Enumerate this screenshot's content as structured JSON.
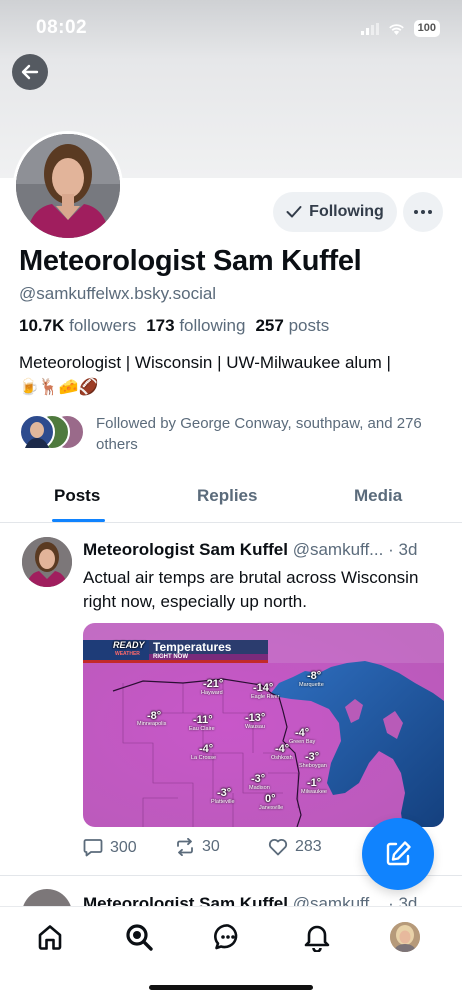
{
  "status_bar": {
    "time": "08:02",
    "battery": "100"
  },
  "profile": {
    "display_name": "Meteorologist Sam Kuffel",
    "handle": "@samkuffelwx.bsky.social",
    "followers_count": "10.7K",
    "followers_label": "followers",
    "following_count": "173",
    "following_label": "following",
    "posts_count": "257",
    "posts_label": "posts",
    "bio_line1": "Meteorologist | Wisconsin | UW-Milwaukee alum |",
    "bio_emojis": "🍺🦌🧀🏈",
    "followed_by": "Followed by George Conway, southpaw, and 276 others",
    "following_button": "Following"
  },
  "tabs": [
    {
      "label": "Posts",
      "active": true
    },
    {
      "label": "Replies",
      "active": false
    },
    {
      "label": "Media",
      "active": false
    }
  ],
  "post": {
    "author": "Meteorologist Sam Kuffel",
    "handle": "@samkuff...",
    "dot": "·",
    "time": "3d",
    "text": "Actual air temps are brutal across Wisconsin right now, especially up north.",
    "replies": "300",
    "reposts": "30",
    "likes": "283",
    "image": {
      "brand_line1": "READY",
      "brand_line2": "WEATHER",
      "title": "Temperatures",
      "subtitle": "RIGHT NOW",
      "readings": [
        {
          "temp": "-21°",
          "city": "Hayward"
        },
        {
          "temp": "-14°",
          "city": "Eagle River"
        },
        {
          "temp": "-8°",
          "city": "Marquette"
        },
        {
          "temp": "-8°",
          "city": "Minneapolis"
        },
        {
          "temp": "-11°",
          "city": "Eau Claire"
        },
        {
          "temp": "-13°",
          "city": "Wausau"
        },
        {
          "temp": "-4°",
          "city": "Green Bay"
        },
        {
          "temp": "-4°",
          "city": "La Crosse"
        },
        {
          "temp": "-4°",
          "city": "Oshkosh"
        },
        {
          "temp": "-3°",
          "city": "Sheboygan"
        },
        {
          "temp": "-3°",
          "city": "Madison"
        },
        {
          "temp": "-1°",
          "city": "Milwaukee"
        },
        {
          "temp": "-3°",
          "city": "Platteville"
        },
        {
          "temp": "0°",
          "city": "Janesville"
        }
      ]
    }
  },
  "next_post": {
    "author": "Meteorologist Sam Kuffel",
    "handle": "@samkuff...",
    "time": "· 3d"
  },
  "colors": {
    "accent": "#1083fe",
    "muted": "#5b6b7b",
    "map_pink": "#c15ec6"
  },
  "icons": [
    "back-arrow-icon",
    "check-icon",
    "more-dots-icon",
    "reply-icon",
    "repost-icon",
    "heart-icon",
    "compose-icon",
    "home-icon",
    "search-icon",
    "chat-icon",
    "bell-icon"
  ]
}
